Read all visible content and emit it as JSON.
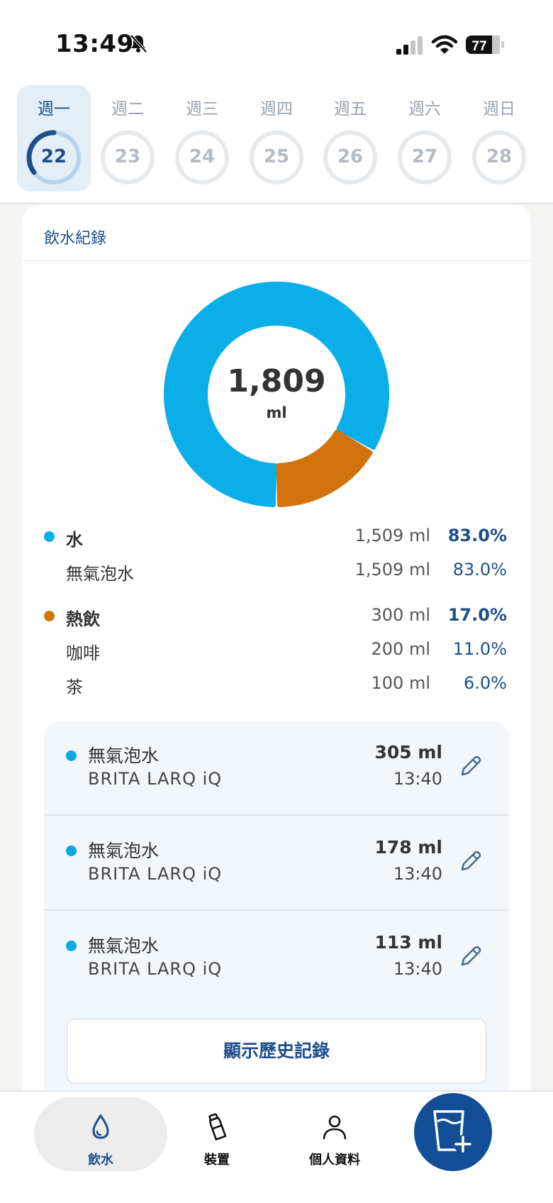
{
  "status_bar": {
    "time": "13:49",
    "battery": "77"
  },
  "week": {
    "days": [
      {
        "label": "週一",
        "num": "22",
        "active": true,
        "progress": 0.6
      },
      {
        "label": "週二",
        "num": "23",
        "active": false,
        "progress": 0
      },
      {
        "label": "週三",
        "num": "24",
        "active": false,
        "progress": 0
      },
      {
        "label": "週四",
        "num": "25",
        "active": false,
        "progress": 0
      },
      {
        "label": "週五",
        "num": "26",
        "active": false,
        "progress": 0
      },
      {
        "label": "週六",
        "num": "27",
        "active": false,
        "progress": 0
      },
      {
        "label": "週日",
        "num": "28",
        "active": false,
        "progress": 0
      }
    ]
  },
  "card": {
    "title": "飲水紀錄",
    "total_value": "1,809",
    "total_unit": "ml"
  },
  "chart_data": {
    "type": "pie",
    "slices": [
      {
        "label": "水",
        "value": 1509,
        "percent": 83.0,
        "color": "#0aaee8"
      },
      {
        "label": "熱飲",
        "value": 300,
        "percent": 17.0,
        "color": "#d1720a"
      }
    ]
  },
  "breakdown": {
    "water": {
      "name": "水",
      "amount": "1,509 ml",
      "pct": "83.0%",
      "color": "#0aaee8"
    },
    "water_sub": {
      "name": "無氣泡水",
      "amount": "1,509 ml",
      "pct": "83.0%"
    },
    "hot": {
      "name": "熱飲",
      "amount": "300 ml",
      "pct": "17.0%",
      "color": "#d1720a"
    },
    "coffee": {
      "name": "咖啡",
      "amount": "200 ml",
      "pct": "11.0%"
    },
    "tea": {
      "name": "茶",
      "amount": "100 ml",
      "pct": "6.0%"
    }
  },
  "entries": [
    {
      "name": "無氣泡水",
      "device": "BRITA LARQ iQ",
      "amount": "305 ml",
      "time": "13:40"
    },
    {
      "name": "無氣泡水",
      "device": "BRITA LARQ iQ",
      "amount": "178 ml",
      "time": "13:40"
    },
    {
      "name": "無氣泡水",
      "device": "BRITA LARQ iQ",
      "amount": "113 ml",
      "time": "13:40"
    }
  ],
  "history_button": "顯示歷史記錄",
  "nav": {
    "drink": "飲水",
    "device": "裝置",
    "profile": "個人資料"
  },
  "icons": {
    "drink": "water-drop-icon",
    "device": "bottle-icon",
    "profile": "person-icon",
    "add": "cup-plus-icon",
    "edit": "pencil-icon"
  }
}
